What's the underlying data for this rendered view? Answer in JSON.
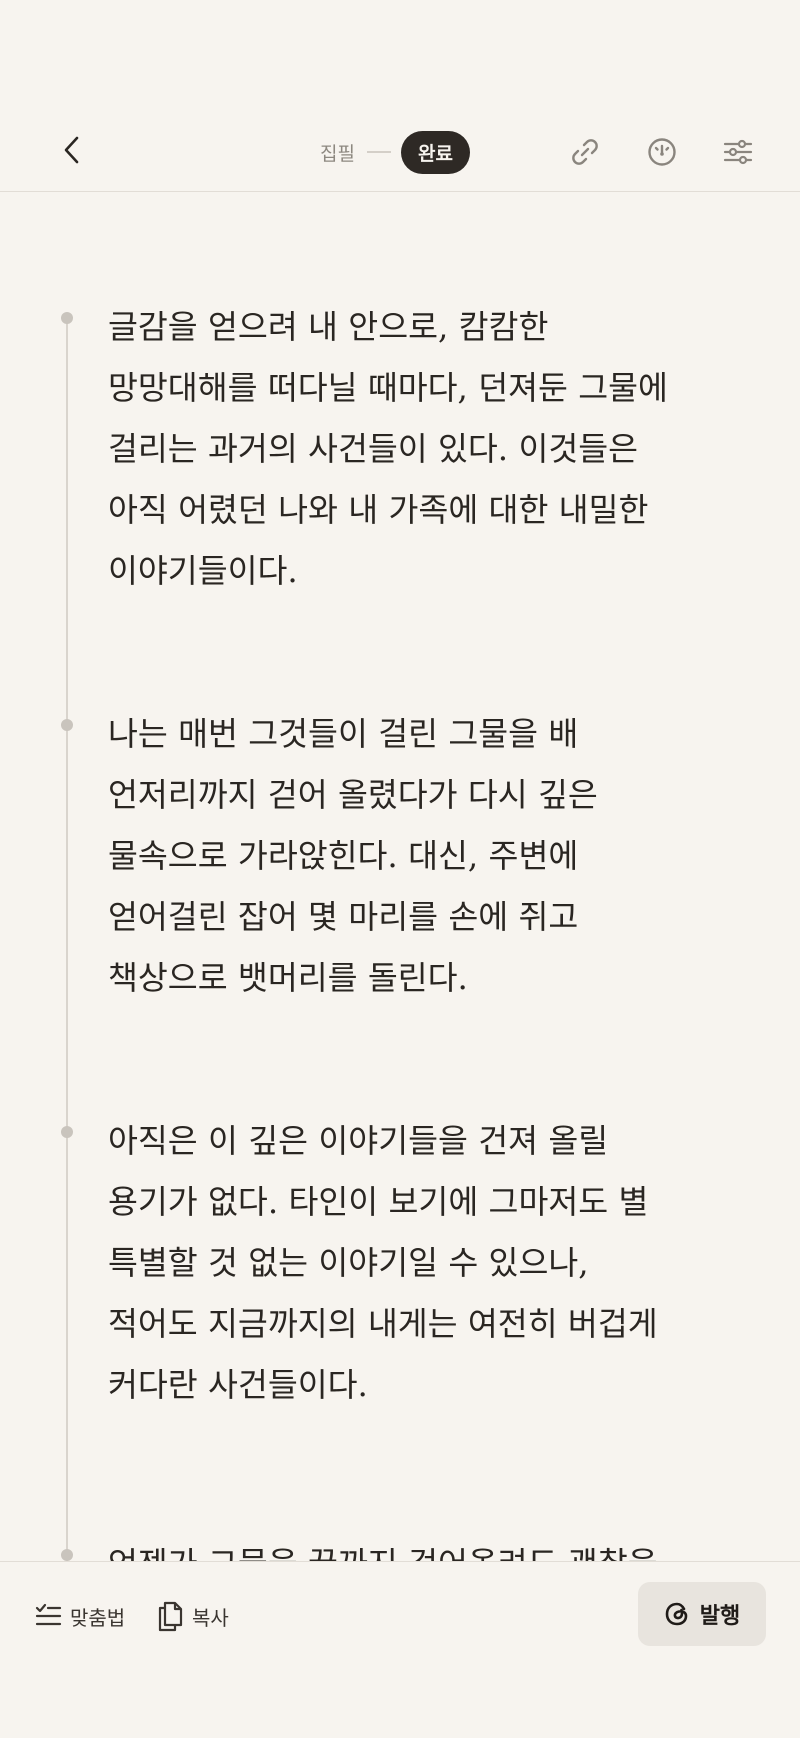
{
  "header": {
    "status_draft": "집필",
    "status_done": "완료",
    "icons": [
      "chevron-left-icon",
      "link-icon",
      "gauge-icon",
      "sliders-icon"
    ]
  },
  "paragraphs": [
    {
      "lines": [
        "글감을 얻으려 내 안으로, 캄캄한",
        "망망대해를 떠다닐 때마다, 던져둔 그물에",
        "걸리는 과거의 사건들이 있다. 이것들은",
        "아직 어렸던 나와 내 가족에 대한 내밀한",
        "이야기들이다."
      ]
    },
    {
      "lines": [
        "나는 매번 그것들이 걸린 그물을 배",
        "언저리까지 걷어 올렸다가 다시 깊은",
        "물속으로 가라앉힌다. 대신, 주변에",
        "얻어걸린 잡어 몇 마리를 손에 쥐고",
        "책상으로 뱃머리를 돌린다."
      ]
    },
    {
      "lines": [
        "아직은 이 깊은 이야기들을 건져 올릴",
        "용기가 없다. 타인이 보기에 그마저도 별",
        "특별할 것 없는 이야기일 수 있으나,",
        "적어도 지금까지의 내게는 여전히 버겁게",
        "커다란 사건들이다."
      ]
    },
    {
      "lines": [
        "언젠가 그물을 끝까지 걷어올려도 괜찮을,"
      ]
    }
  ],
  "bottom": {
    "spellcheck_label": "맞춤법",
    "copy_label": "복사",
    "publish_label": "발행"
  },
  "colors": {
    "background": "#f7f4ef",
    "text": "#2a2622",
    "pill": "#2e2925",
    "publish_bg": "#e8e4de"
  }
}
